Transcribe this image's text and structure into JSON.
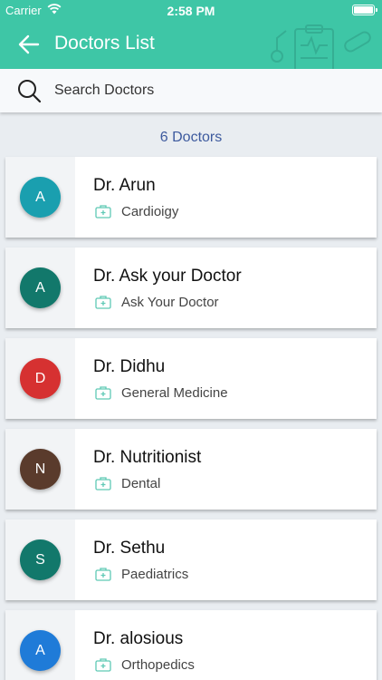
{
  "status_bar": {
    "carrier": "Carrier",
    "time": "2:58 PM",
    "wifi_icon": "wifi-icon",
    "battery_icon": "battery-icon"
  },
  "header": {
    "title": "Doctors List",
    "back_icon": "arrow-left-icon",
    "background_color": "#3ec6a6"
  },
  "search": {
    "placeholder": "Search Doctors",
    "value": "",
    "icon": "search-icon"
  },
  "count_label": "6 Doctors",
  "doctors": [
    {
      "initial": "A",
      "name": "Dr. Arun",
      "specialty": "Cardioigy",
      "color": "#1a9faf"
    },
    {
      "initial": "A",
      "name": "Dr. Ask your Doctor",
      "specialty": "Ask Your Doctor",
      "color": "#12786b"
    },
    {
      "initial": "D",
      "name": "Dr. Didhu",
      "specialty": "General Medicine",
      "color": "#d63131"
    },
    {
      "initial": "N",
      "name": "Dr. Nutritionist",
      "specialty": "Dental",
      "color": "#5a3b2c"
    },
    {
      "initial": "S",
      "name": "Dr. Sethu",
      "specialty": "Paediatrics",
      "color": "#12786b"
    },
    {
      "initial": "A",
      "name": "Dr. alosious",
      "specialty": "Orthopedics",
      "color": "#1f7bd8"
    }
  ]
}
